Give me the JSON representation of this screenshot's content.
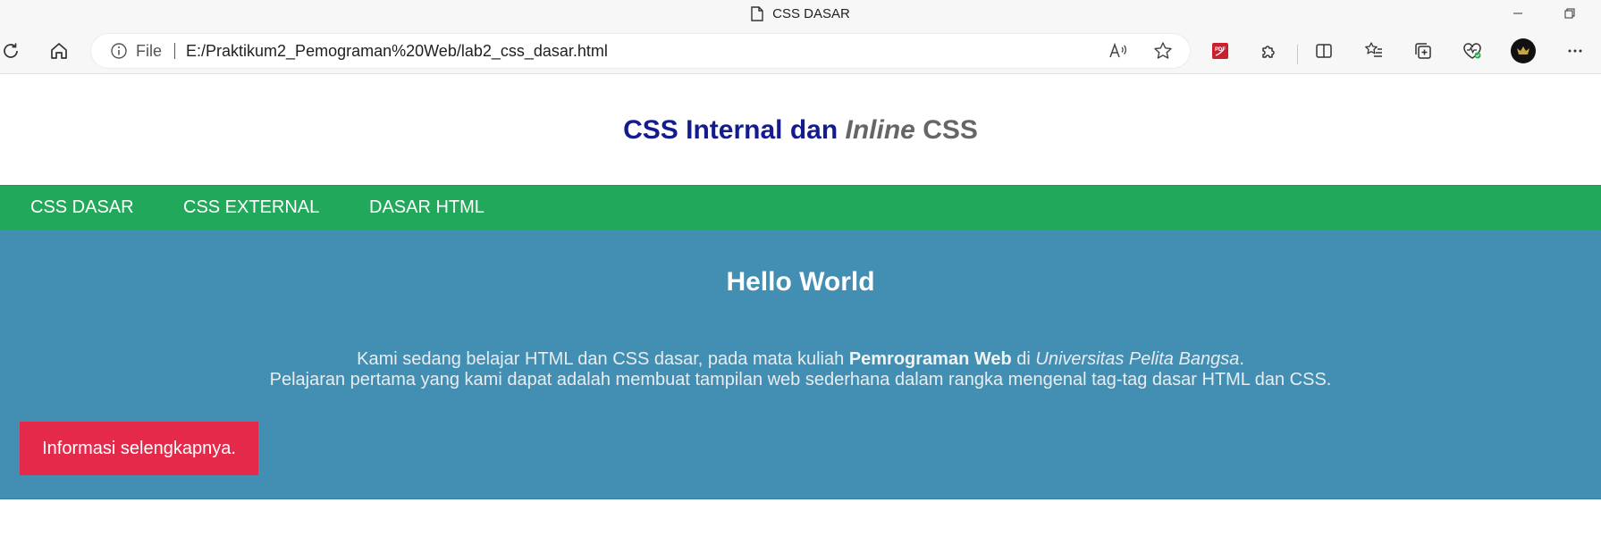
{
  "window": {
    "title": "CSS DASAR"
  },
  "toolbar": {
    "file_label": "File",
    "url": "E:/Praktikum2_Pemograman%20Web/lab2_css_dasar.html",
    "pdf_label": "PDF"
  },
  "page": {
    "heading_part1": "CSS Internal dan",
    "heading_inline": "Inline",
    "heading_css": "CSS",
    "nav": [
      {
        "label": "CSS DASAR"
      },
      {
        "label": "CSS EXTERNAL"
      },
      {
        "label": "DASAR HTML"
      }
    ],
    "hero": {
      "title": "Hello World",
      "line1_pre": "Kami sedang belajar HTML dan CSS dasar, pada mata kuliah",
      "line1_bold": "Pemrograman Web",
      "line1_mid": "di",
      "line1_italic": "Universitas Pelita Bangsa",
      "line1_end": ".",
      "line2": "Pelajaran pertama yang kami dapat adalah membuat tampilan web sederhana dalam rangka mengenal tag-tag dasar HTML dan CSS.",
      "button_label": "Informasi selengkapnya."
    }
  },
  "colors": {
    "heading_blue": "#131b8f",
    "heading_gray": "#666666",
    "nav_green": "#22a85a",
    "hero_blue": "#428fb3",
    "button_red": "#e4294a"
  },
  "icons": {
    "window": [
      "document-icon",
      "minimize-icon",
      "restore-icon"
    ],
    "toolbar": [
      "refresh-icon",
      "home-icon",
      "info-icon",
      "read-aloud-icon",
      "favorite-star-icon",
      "pdf-extension-icon",
      "extensions-puzzle-icon",
      "split-screen-icon",
      "favorites-icon",
      "collections-icon",
      "browser-essentials-icon",
      "profile-avatar",
      "more-menu-icon"
    ]
  }
}
